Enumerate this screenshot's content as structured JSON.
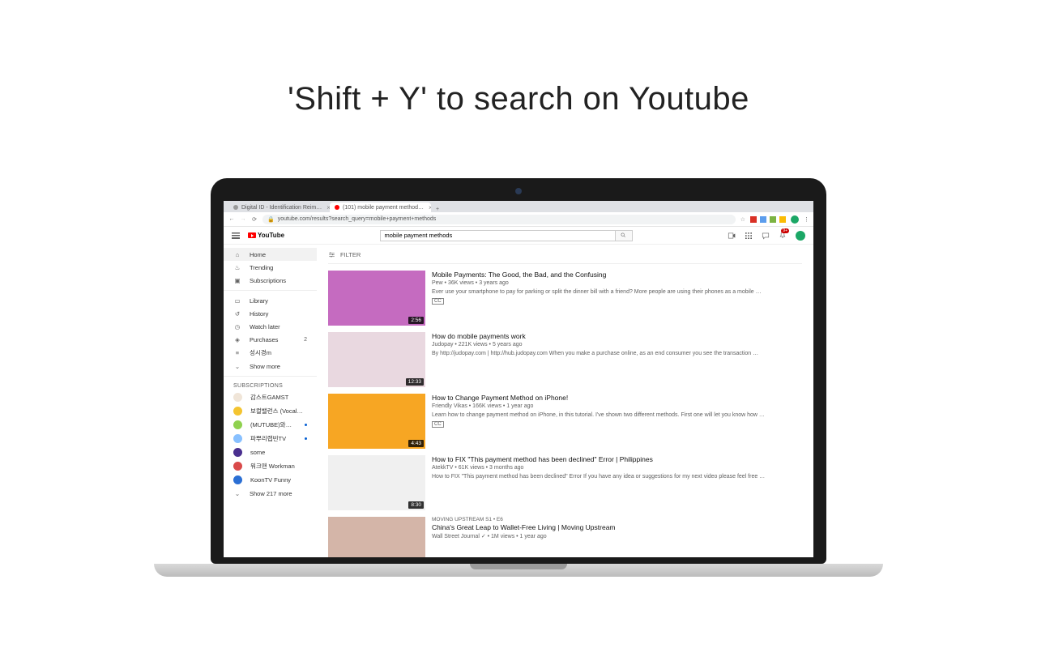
{
  "heading": "'Shift + Y' to search on Youtube",
  "browser": {
    "tabs": [
      {
        "label": "Digital ID - Identification Reim…"
      },
      {
        "label": "(101) mobile payment method…"
      }
    ],
    "newtab": "+",
    "address": "youtube.com/results?search_query=mobile+payment+methods"
  },
  "yt": {
    "logo": "YouTube",
    "search_value": "mobile payment methods",
    "notif_count": "9+",
    "sidebar": {
      "primary": [
        {
          "icon": "home",
          "label": "Home"
        },
        {
          "icon": "fire",
          "label": "Trending"
        },
        {
          "icon": "subs",
          "label": "Subscriptions"
        }
      ],
      "secondary": [
        {
          "icon": "lib",
          "label": "Library"
        },
        {
          "icon": "hist",
          "label": "History"
        },
        {
          "icon": "clock",
          "label": "Watch later"
        },
        {
          "icon": "tag",
          "label": "Purchases",
          "count": "2"
        },
        {
          "icon": "list",
          "label": "성시경m"
        },
        {
          "icon": "chev",
          "label": "Show more"
        }
      ],
      "subs_head": "SUBSCRIPTIONS",
      "subs": [
        {
          "label": "감스트GAMST",
          "color": "#f0e5d8"
        },
        {
          "label": "보컬밸런스 (Vocal…",
          "color": "#f4c430"
        },
        {
          "label": "(MUTUBE)와꾸…",
          "color": "#8fd14f",
          "dot": true
        },
        {
          "label": "파뿌리랩빈TV",
          "color": "#88c0ff",
          "dot": true
        },
        {
          "label": "some",
          "color": "#4a2f8f"
        },
        {
          "label": "워크맨 Workman",
          "color": "#d94a4a"
        },
        {
          "label": "KoonTV Funny",
          "color": "#2b6fd4"
        }
      ],
      "show_more": "Show 217 more"
    },
    "filter_label": "FILTER",
    "results": [
      {
        "title": "Mobile Payments: The Good, the Bad, and the Confusing",
        "byline": "Pew • 36K views • 3 years ago",
        "desc": "Ever use your smartphone to pay for parking or split the dinner bill with a friend? More people are using their phones as a mobile …",
        "duration": "2:56",
        "cc": "CC",
        "thumb_bg": "#c56bc0"
      },
      {
        "title": "How do mobile payments work",
        "byline": "Judopay • 221K views • 5 years ago",
        "desc": "By http://judopay.com | http://hub.judopay.com When you make a purchase online, as an end consumer you see the transaction …",
        "duration": "12:33",
        "thumb_bg": "#e9d8e0"
      },
      {
        "title": "How to Change Payment Method on iPhone!",
        "byline": "Friendly Vikas • 166K views • 1 year ago",
        "desc": "Learn how to change payment method on iPhone, in this tutorial. I've shown two different methods. First one will let you know how …",
        "duration": "4:43",
        "cc": "CC",
        "thumb_bg": "#f7a623"
      },
      {
        "title": "How to FIX \"This payment method has been declined\" Error | Philippines",
        "byline": "AtekkTV • 61K views • 3 months ago",
        "desc": "How to FIX \"This payment method has been declined\" Error If you have any idea or suggestions for my next video please feel free …",
        "duration": "8:30",
        "thumb_bg": "#f0f0f0"
      },
      {
        "series": "MOVING UPSTREAM  S1 • E6",
        "title": "China's Great Leap to Wallet-Free Living | Moving Upstream",
        "byline": "Wall Street Journal ✓ • 1M views • 1 year ago",
        "thumb_bg": "#d4b5a8"
      }
    ]
  }
}
